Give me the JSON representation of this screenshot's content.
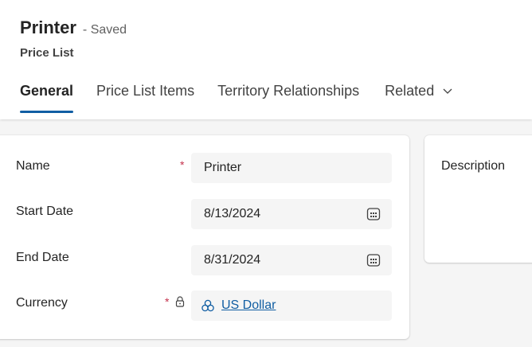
{
  "header": {
    "title": "Printer",
    "status": "- Saved",
    "entity": "Price List"
  },
  "tabs": [
    {
      "label": "General",
      "active": true
    },
    {
      "label": "Price List Items",
      "active": false
    },
    {
      "label": "Territory Relationships",
      "active": false
    },
    {
      "label": "Related",
      "active": false
    }
  ],
  "form": {
    "name": {
      "label": "Name",
      "required": "*",
      "value": "Printer"
    },
    "start_date": {
      "label": "Start Date",
      "value": "8/13/2024"
    },
    "end_date": {
      "label": "End Date",
      "value": "8/31/2024"
    },
    "currency": {
      "label": "Currency",
      "required": "*",
      "value": "US Dollar"
    }
  },
  "side": {
    "description_label": "Description"
  },
  "colors": {
    "accent": "#115ea3",
    "required": "#c4314b",
    "field_bg": "#f5f5f5"
  }
}
